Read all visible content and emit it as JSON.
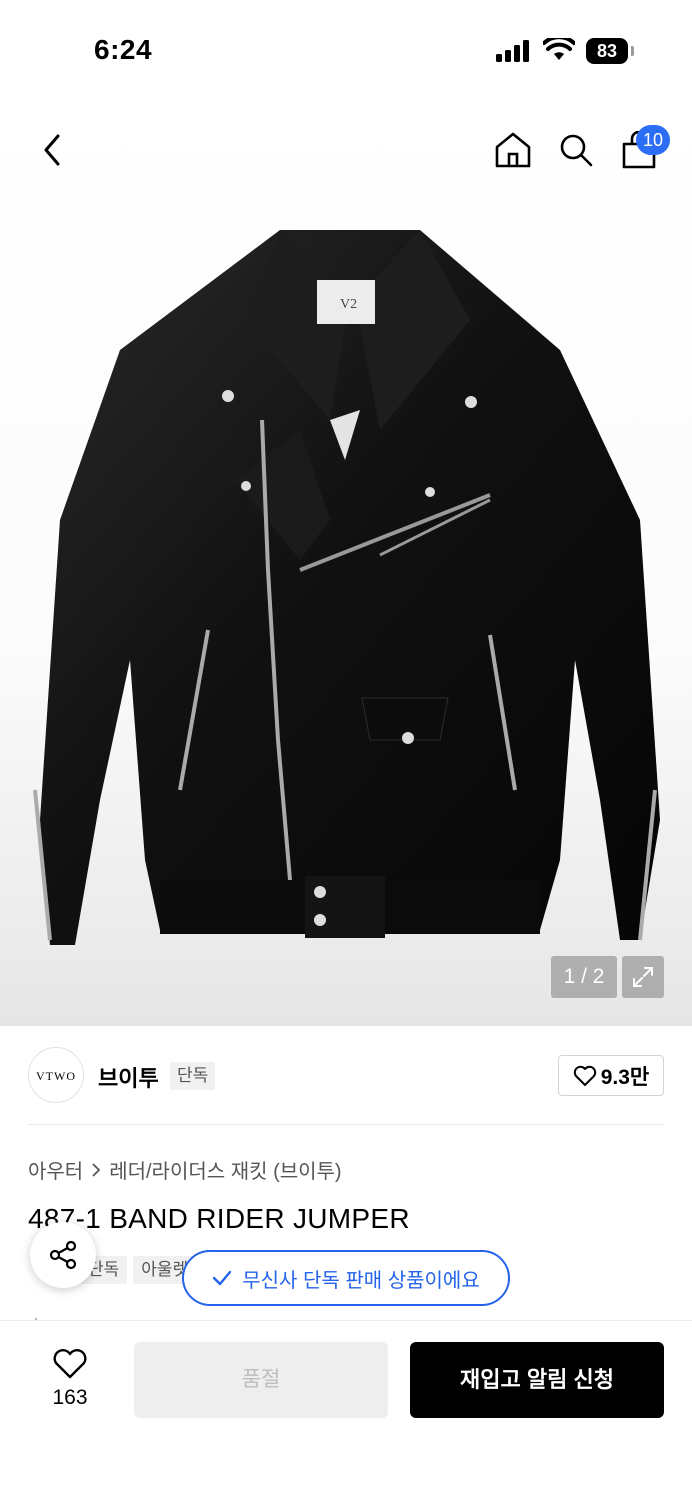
{
  "status_bar": {
    "time": "6:24",
    "battery": "83"
  },
  "header": {
    "cart_count": "10"
  },
  "gallery": {
    "counter": "1 / 2",
    "label_brand": "V2"
  },
  "brand": {
    "logo_text": "VTWO",
    "name": "브이투",
    "tag": "단독",
    "likes": "9.3만"
  },
  "breadcrumb": {
    "items": [
      "아우터",
      "레더/라이더스 재킷 (브이투)"
    ]
  },
  "product": {
    "title": "487-1 BAND RIDER JUMPER",
    "tags": [
      "단독",
      "아울렛"
    ]
  },
  "notice": {
    "exclusive": "무신사 단독 판매 상품이에요"
  },
  "bottom_bar": {
    "wish_count": "163",
    "soldout_label": "품절",
    "restock_label": "재입고 알림 신청"
  },
  "colors": {
    "accent_blue": "#2563eb",
    "badge_blue": "#2b6ef5",
    "cta_black": "#000000",
    "disabled_gray": "#eeeeee"
  }
}
